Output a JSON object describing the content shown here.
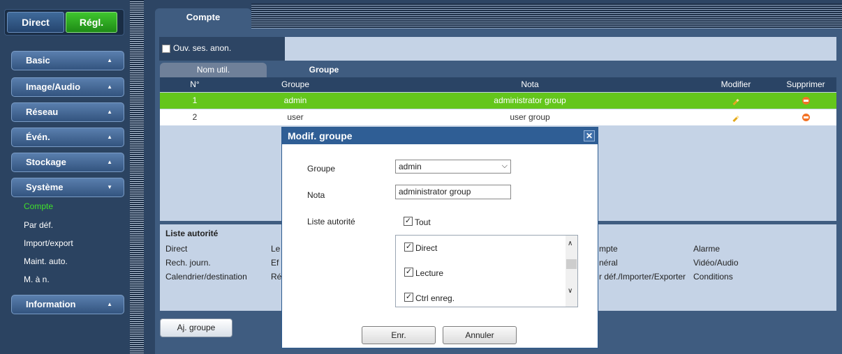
{
  "nav": {
    "direct": "Direct",
    "regl": "Régl.",
    "menus": [
      {
        "label": "Basic"
      },
      {
        "label": "Image/Audio"
      },
      {
        "label": "Réseau"
      },
      {
        "label": "Évén."
      },
      {
        "label": "Stockage"
      },
      {
        "label": "Système"
      },
      {
        "label": "Information"
      }
    ],
    "system_items": [
      "Compte",
      "Par déf.",
      "Import/export",
      "Maint. auto.",
      "M. à n."
    ]
  },
  "tab": "Compte",
  "anon_label": "Ouv. ses. anon.",
  "subtabs": [
    "Nom util.",
    "Groupe"
  ],
  "table": {
    "headers": [
      "N°",
      "Groupe",
      "Nota",
      "Modifier",
      "Supprimer"
    ],
    "rows": [
      {
        "no": "1",
        "group": "admin",
        "nota": "administrator group"
      },
      {
        "no": "2",
        "group": "user",
        "nota": "user group"
      }
    ]
  },
  "permissions": {
    "title": "Liste autorité",
    "col1": [
      "Direct",
      "Rech. journ.",
      "Calendrier/destination"
    ],
    "col2": [
      "Le",
      "Ef",
      "Ré"
    ],
    "col3": [
      "mpte",
      "néral",
      "r déf./Importer/Exporter"
    ],
    "col4": [
      "Alarme",
      "Vidéo/Audio",
      "Conditions"
    ]
  },
  "add_group": "Aj. groupe",
  "modal": {
    "title": "Modif. groupe",
    "close": "✕",
    "group_label": "Groupe",
    "group_value": "admin",
    "nota_label": "Nota",
    "nota_value": "administrator group",
    "authority_label": "Liste autorité",
    "all_label": "Tout",
    "items": [
      "Direct",
      "Lecture",
      "Ctrl enreg."
    ],
    "save": "Enr.",
    "cancel": "Annuler"
  },
  "colors": {
    "selected_row": "#64c61c",
    "active_nav": "#3fe02b",
    "delete_icon": "#f37326"
  }
}
